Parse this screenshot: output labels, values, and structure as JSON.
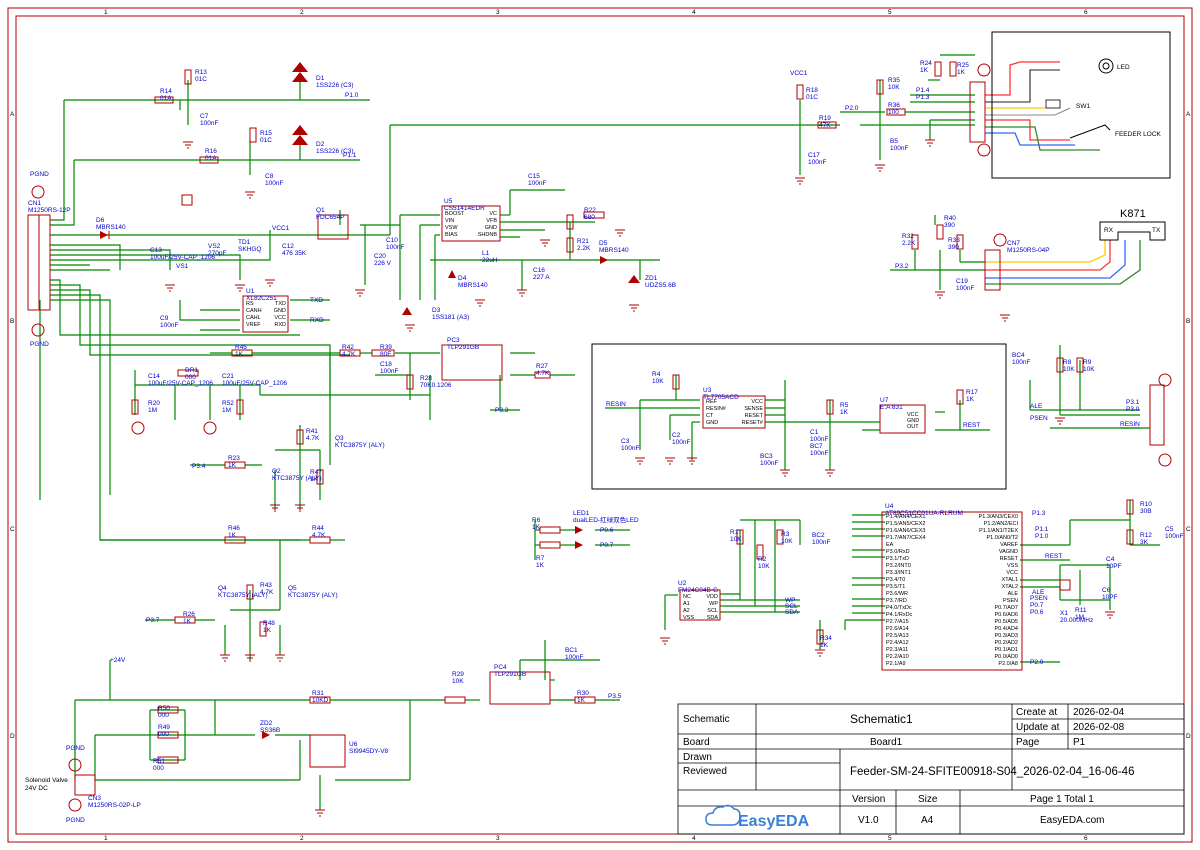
{
  "border": {
    "columns": [
      "1",
      "2",
      "3",
      "4",
      "5",
      "6"
    ],
    "rows": [
      "A",
      "B",
      "C",
      "D"
    ]
  },
  "title_block": {
    "schematic_label": "Schematic",
    "schematic_name": "Schematic1",
    "create_label": "Create at",
    "create_date": "2026-02-04",
    "update_label": "Update at",
    "update_date": "2026-02-08",
    "board_label": "Board",
    "board_name": "Board1",
    "page_label": "Page",
    "page_value": "P1",
    "drawn_label": "Drawn",
    "reviewed_label": "Reviewed",
    "file_name": "Feeder-SM-24-SFITE00918-S04_2026-02-04_16-06-46",
    "version_label": "Version",
    "version_value": "V1.0",
    "size_label": "Size",
    "size_value": "A4",
    "page_total": "Page  1  Total  1",
    "logo_text": "EasyEDA",
    "site": "EasyEDA.com"
  },
  "feeder_box": {
    "labels": [
      "LED",
      "SW1",
      "FEEDER LOCK"
    ]
  },
  "k871": {
    "title": "K871",
    "rx": "RX",
    "tx": "TX"
  },
  "components": [
    {
      "ref": "R13",
      "val": "01C"
    },
    {
      "ref": "R14",
      "val": "01A"
    },
    {
      "ref": "C7",
      "val": "100nF"
    },
    {
      "ref": "R15",
      "val": "01C"
    },
    {
      "ref": "R16",
      "val": "01A"
    },
    {
      "ref": "C8",
      "val": "100nF"
    },
    {
      "ref": "D1",
      "val": "1SS226 (C3)"
    },
    {
      "ref": "D2",
      "val": "1SS226 (C3)"
    },
    {
      "ref": "CN1",
      "val": "M1250RS-12P"
    },
    {
      "ref": "D6",
      "val": "MBRS140"
    },
    {
      "ref": "C13",
      "val": "100uF/25V-CAP_1206"
    },
    {
      "ref": "VS1",
      "val": ""
    },
    {
      "ref": "VS2",
      "val": "270pF"
    },
    {
      "ref": "TD1",
      "val": "SKHGQ"
    },
    {
      "ref": "C12",
      "val": "476 35K"
    },
    {
      "ref": "Q1",
      "val": "FDC654P"
    },
    {
      "ref": "C20",
      "val": "226 V"
    },
    {
      "ref": "C10",
      "val": "100nF"
    },
    {
      "ref": "U5",
      "val": "CS51414EDR"
    },
    {
      "ref": "C15",
      "val": "100nF"
    },
    {
      "ref": "R22",
      "val": "680"
    },
    {
      "ref": "R21",
      "val": "2.2K"
    },
    {
      "ref": "D5",
      "val": "MBRS140"
    },
    {
      "ref": "L1",
      "val": "22uH"
    },
    {
      "ref": "C16",
      "val": "227 A"
    },
    {
      "ref": "D4",
      "val": "MBRS140"
    },
    {
      "ref": "D3",
      "val": "1SS181 (A3)"
    },
    {
      "ref": "ZD1",
      "val": "UDZS5.6B"
    },
    {
      "ref": "U1",
      "val": "XL82C251"
    },
    {
      "ref": "C9",
      "val": "100nF"
    },
    {
      "ref": "R45",
      "val": "1K"
    },
    {
      "ref": "R42",
      "val": "4.7K"
    },
    {
      "ref": "R39",
      "val": "80E"
    },
    {
      "ref": "C18",
      "val": "100nF"
    },
    {
      "ref": "R28",
      "val": "70K0.1206"
    },
    {
      "ref": "PC3",
      "val": "TLP291GB"
    },
    {
      "ref": "R27",
      "val": "4.7K"
    },
    {
      "ref": "C14",
      "val": "100uF/25V-CAP_1206"
    },
    {
      "ref": "R20",
      "val": "1M"
    },
    {
      "ref": "DR1",
      "val": "000"
    },
    {
      "ref": "C21",
      "val": "100uF/25V-CAP_1206"
    },
    {
      "ref": "R52",
      "val": "1M"
    },
    {
      "ref": "R41",
      "val": "4.7K"
    },
    {
      "ref": "Q3",
      "val": "KTC3875Y (ALY)"
    },
    {
      "ref": "R23",
      "val": "1K"
    },
    {
      "ref": "Q2",
      "val": "KTC3875Y (ALY)"
    },
    {
      "ref": "R47",
      "val": "1K"
    },
    {
      "ref": "R46",
      "val": "1K"
    },
    {
      "ref": "R44",
      "val": "4.7K"
    },
    {
      "ref": "Q4",
      "val": "KTC3875Y (ALY)"
    },
    {
      "ref": "R43",
      "val": "4.7K"
    },
    {
      "ref": "Q5",
      "val": "KTC3875Y (ALY)"
    },
    {
      "ref": "R26",
      "val": "1K"
    },
    {
      "ref": "R48",
      "val": "1K"
    },
    {
      "ref": "R50",
      "val": "000"
    },
    {
      "ref": "R49",
      "val": "000"
    },
    {
      "ref": "R51",
      "val": "000"
    },
    {
      "ref": "ZD2",
      "val": "SS36B"
    },
    {
      "ref": "R31",
      "val": "10KD"
    },
    {
      "ref": "U6",
      "val": "SI9945DY-V8"
    },
    {
      "ref": "CN3",
      "val": "M1250RS-02P-LP"
    },
    {
      "ref": "R29",
      "val": "10K"
    },
    {
      "ref": "PC4",
      "val": "TLP291GB"
    },
    {
      "ref": "BC1",
      "val": "100nF"
    },
    {
      "ref": "R30",
      "val": "1K"
    },
    {
      "ref": "R18",
      "val": "01C"
    },
    {
      "ref": "R19",
      "val": "47K"
    },
    {
      "ref": "C17",
      "val": "100nF"
    },
    {
      "ref": "R35",
      "val": "10K"
    },
    {
      "ref": "R36",
      "val": "100"
    },
    {
      "ref": "B5",
      "val": "100nF"
    },
    {
      "ref": "R24",
      "val": "1K"
    },
    {
      "ref": "R25",
      "val": "1K"
    },
    {
      "ref": "R32",
      "val": "2.2K"
    },
    {
      "ref": "R40",
      "val": "390"
    },
    {
      "ref": "R33",
      "val": "390"
    },
    {
      "ref": "C19",
      "val": "100nF"
    },
    {
      "ref": "CN7",
      "val": "M1250RS-04P"
    },
    {
      "ref": "R4",
      "val": "10K"
    },
    {
      "ref": "U3",
      "val": "TL7705ACD"
    },
    {
      "ref": "C3",
      "val": "100nF"
    },
    {
      "ref": "C2",
      "val": "100nF"
    },
    {
      "ref": "BC3",
      "val": "100nF"
    },
    {
      "ref": "R5",
      "val": "1K"
    },
    {
      "ref": "C1",
      "val": "100nF"
    },
    {
      "ref": "BC7",
      "val": "100nF"
    },
    {
      "ref": "U7",
      "val": "E:A 831"
    },
    {
      "ref": "R17",
      "val": "1K"
    },
    {
      "ref": "BC4",
      "val": "100nF"
    },
    {
      "ref": "R8",
      "val": "10K"
    },
    {
      "ref": "R9",
      "val": "10K"
    },
    {
      "ref": "LED1",
      "val": "dualLED-红绿双色LED"
    },
    {
      "ref": "R6",
      "val": "1K"
    },
    {
      "ref": "R7",
      "val": "1K"
    },
    {
      "ref": "R1",
      "val": "10K"
    },
    {
      "ref": "R2",
      "val": "10K"
    },
    {
      "ref": "R3",
      "val": "10K"
    },
    {
      "ref": "BC2",
      "val": "100nF"
    },
    {
      "ref": "U2",
      "val": "FM24C04B-G"
    },
    {
      "ref": "R34",
      "val": "1K"
    },
    {
      "ref": "U4",
      "val": "AT89C51CC01UA-RLRUM"
    },
    {
      "ref": "R10",
      "val": "30B"
    },
    {
      "ref": "R12",
      "val": "3K"
    },
    {
      "ref": "C5",
      "val": "100nF"
    },
    {
      "ref": "C4",
      "val": "10PF"
    },
    {
      "ref": "C6",
      "val": "10PF"
    },
    {
      "ref": "X1",
      "val": "20.000MHz"
    },
    {
      "ref": "R11",
      "val": "1M"
    }
  ],
  "nets": {
    "p10": "P1.0",
    "p11": "P1.1",
    "p20": "P2.0",
    "p32": "P3.2",
    "p33": "P3.3",
    "p34": "P3.4",
    "p37": "P3.7",
    "p35": "P3.5",
    "p31": "P3.1",
    "p30": "P3.0",
    "p14": "P1.4",
    "p13": "P1.3",
    "p06": "P0.6",
    "p07": "P0.7",
    "txd": "TXD",
    "rxd": "RXD",
    "resin": "RESIN",
    "rest": "REST",
    "ale": "ALE",
    "psen": "PSEN",
    "wp": "WP",
    "sda": "SDA",
    "scl": "SCL",
    "vcc": "VCC",
    "gnd": "GND",
    "pgnd": "PGND",
    "v24": "+24V",
    "vcc1": "VCC1"
  },
  "misc": {
    "solenoid": "Solenoid Valve\n24V DC",
    "u4_left_pins": [
      "P1.4/AN4/CEX1",
      "P1.5/AN5/CEX2",
      "P1.6/AN6/CEX3",
      "P1.7/AN7/CEX4",
      "EA",
      "P3.0/RxD",
      "P3.1/TxD",
      "P3.2/INT0",
      "P3.3/INT1",
      "P3.4/T0",
      "P3.5/T1",
      "P3.6/WR",
      "P3.7/RD",
      "P4.0/TxDc",
      "P4.1/RxDc",
      "P2.7/A15",
      "P2.6/A14",
      "P2.5/A13",
      "P2.4/A12",
      "P2.3/A11",
      "P2.2/A10",
      "P2.1/A9"
    ],
    "u4_right_pins": [
      "P1.3/AN3/CEX0",
      "P1.2/AN2/ECI",
      "P1.1/AN1/T2EX",
      "P1.0/AN0/T2",
      "VAREF",
      "VAGND",
      "RESET",
      "VSS",
      "VCC",
      "XTAL1",
      "XTAL2",
      "ALE",
      "PSEN",
      "P0.7/AD7",
      "P0.6/AD6",
      "P0.5/AD5",
      "P0.4/AD4",
      "P0.3/AD3",
      "P0.2/AD2",
      "P0.1/AD1",
      "P0.0/AD0",
      "P2.0/A8"
    ],
    "u1_pins_left": [
      "RS",
      "CANH",
      "CAHL",
      "VREF"
    ],
    "u1_pins_right": [
      "TXD",
      "GND",
      "VCC",
      "RXD"
    ],
    "u5_pins_left": [
      "BOOST",
      "VIN",
      "VSW",
      "BIAS"
    ],
    "u5_pins_right": [
      "VC",
      "VFB",
      "GND",
      "SHDNB"
    ],
    "u3_pins_left": [
      "REF",
      "RESIN#",
      "CT",
      "GND"
    ],
    "u3_pins_right": [
      "VCC",
      "SENSE",
      "RESET",
      "RESET#"
    ],
    "u7_pins": [
      "VCC",
      "GND",
      "OUT"
    ],
    "u2_pins_left": [
      "NC",
      "A1",
      "A2",
      "VSS"
    ],
    "u2_pins_right": [
      "VDD",
      "WP",
      "SCL",
      "SDA"
    ]
  }
}
